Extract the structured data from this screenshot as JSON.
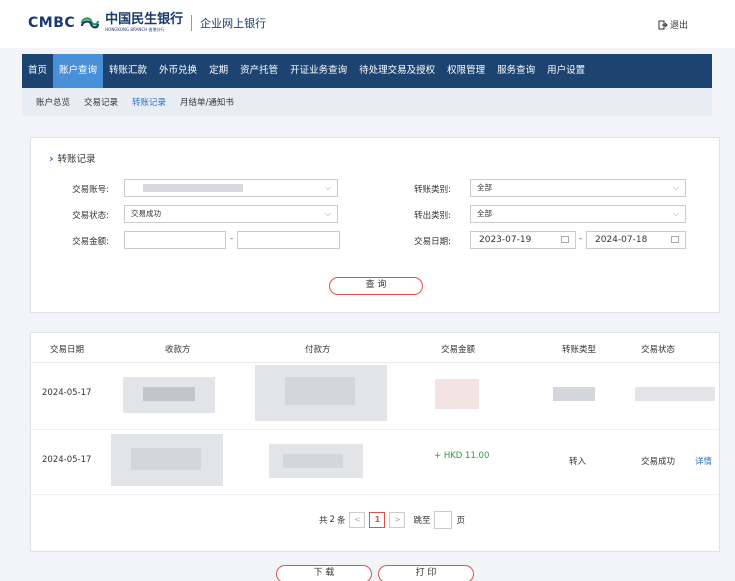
{
  "header": {
    "brand_en": "CMBC",
    "brand_cn": "中国民生银行",
    "brand_cn_sub": "HONGKONG BRANCH 香港分行",
    "product": "企业网上银行",
    "logout": "退出"
  },
  "nav": [
    "首页",
    "账户查询",
    "转账汇款",
    "外币兑换",
    "定期",
    "资产托管",
    "开证业务查询",
    "待处理交易及授权",
    "权限管理",
    "服务查询",
    "用户设置"
  ],
  "nav_active": 1,
  "subnav": [
    "账户总览",
    "交易记录",
    "转账记录",
    "月结单/通知书"
  ],
  "subnav_active": 2,
  "section_title": "转账记录",
  "form": {
    "account_label": "交易账号:",
    "transfer_type_label": "转账类别:",
    "transfer_type_value": "全部",
    "status_label": "交易状态:",
    "status_value": "交易成功",
    "out_type_label": "转出类别:",
    "out_type_value": "全部",
    "amount_label": "交易金额:",
    "date_label": "交易日期:",
    "date_from": "2023-07-19",
    "date_to": "2024-07-18",
    "query_button": "查 询"
  },
  "table": {
    "headers": [
      "交易日期",
      "收款方",
      "付款方",
      "交易金额",
      "转账类型",
      "交易状态"
    ],
    "rows": [
      {
        "date": "2024-05-17",
        "amount": "",
        "type": "",
        "status": "",
        "action": ""
      },
      {
        "date": "2024-05-17",
        "amount": "+ HKD 11.00",
        "type": "转入",
        "status": "交易成功",
        "action": "详情"
      }
    ]
  },
  "pager": {
    "total_prefix": "共",
    "total": "2",
    "total_suffix": "条",
    "prev": "<",
    "current": "1",
    "next": ">",
    "goto_prefix": "跳至",
    "goto_suffix": "页"
  },
  "footer": {
    "download": "下 载",
    "print": "打 印"
  },
  "colors": {
    "nav_bg": "#1d4470",
    "nav_active": "#4a90d9",
    "accent_red": "#d9534f",
    "green": "#2c9a3c",
    "link": "#2a73c7"
  }
}
